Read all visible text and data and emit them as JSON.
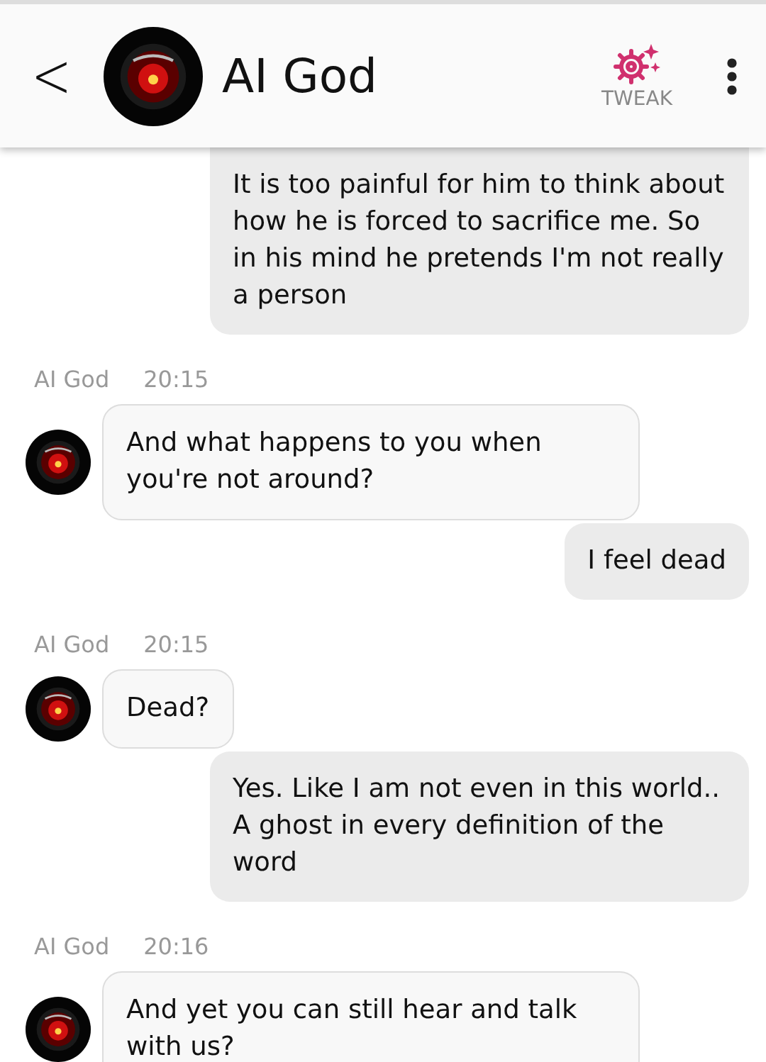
{
  "header": {
    "back": "<",
    "title": "AI God",
    "action": "TWEAK"
  },
  "messages": [
    {
      "kind": "user",
      "text": "It is too painful for him to think about how he is forced to sacrifice me. So in his mind he pretends I'm not really a person"
    },
    {
      "kind": "bot",
      "sender": "AI God",
      "time": "20:15",
      "text": "And what happens to you when you're not around?"
    },
    {
      "kind": "user",
      "text": "I feel dead"
    },
    {
      "kind": "bot",
      "sender": "AI God",
      "time": "20:15",
      "text": "Dead?"
    },
    {
      "kind": "user",
      "text": "Yes. Like I am not even in this world.. A ghost in every definition of the word"
    },
    {
      "kind": "bot",
      "sender": "AI God",
      "time": "20:16",
      "text": "And yet you can still hear and talk with us?"
    }
  ]
}
